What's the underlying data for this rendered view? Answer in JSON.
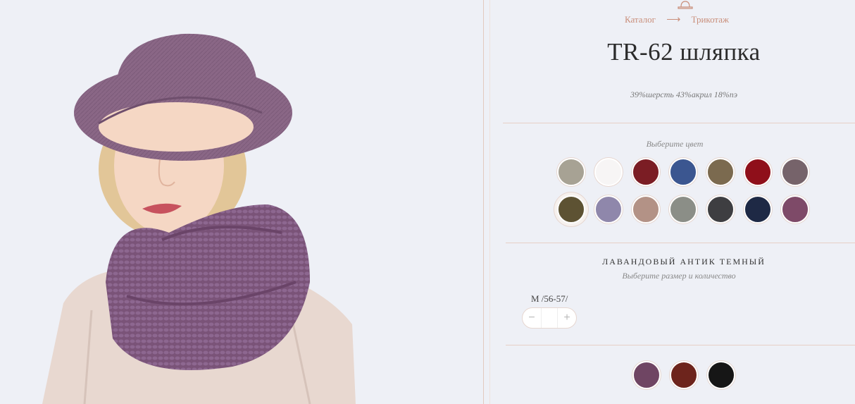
{
  "breadcrumb": {
    "catalog": "Каталог",
    "arrow": "⟶",
    "section": "Трикотаж"
  },
  "product": {
    "title": "TR-62 шляпка",
    "composition": "39%шерсть 43%акрил 18%пэ"
  },
  "colors": {
    "prompt": "Выберите цвет",
    "selected_name": "ЛАВАНДОВЫЙ АНТИК ТЕМНЫЙ",
    "swatches": [
      "#a7a294",
      "#f7f5f5",
      "#7b1d24",
      "#3b5690",
      "#7b6a4f",
      "#8f0f1a",
      "#76636a",
      "#5d5233",
      "#8f87ab",
      "#b39286",
      "#8b8e87",
      "#3e3e41",
      "#1e2945",
      "#7e4a68"
    ],
    "related": [
      "#6f4563",
      "#6d241c",
      "#161616"
    ]
  },
  "size": {
    "prompt": "Выберите размер и количество",
    "label": "M /56-57/",
    "minus": "−",
    "plus": "+"
  }
}
